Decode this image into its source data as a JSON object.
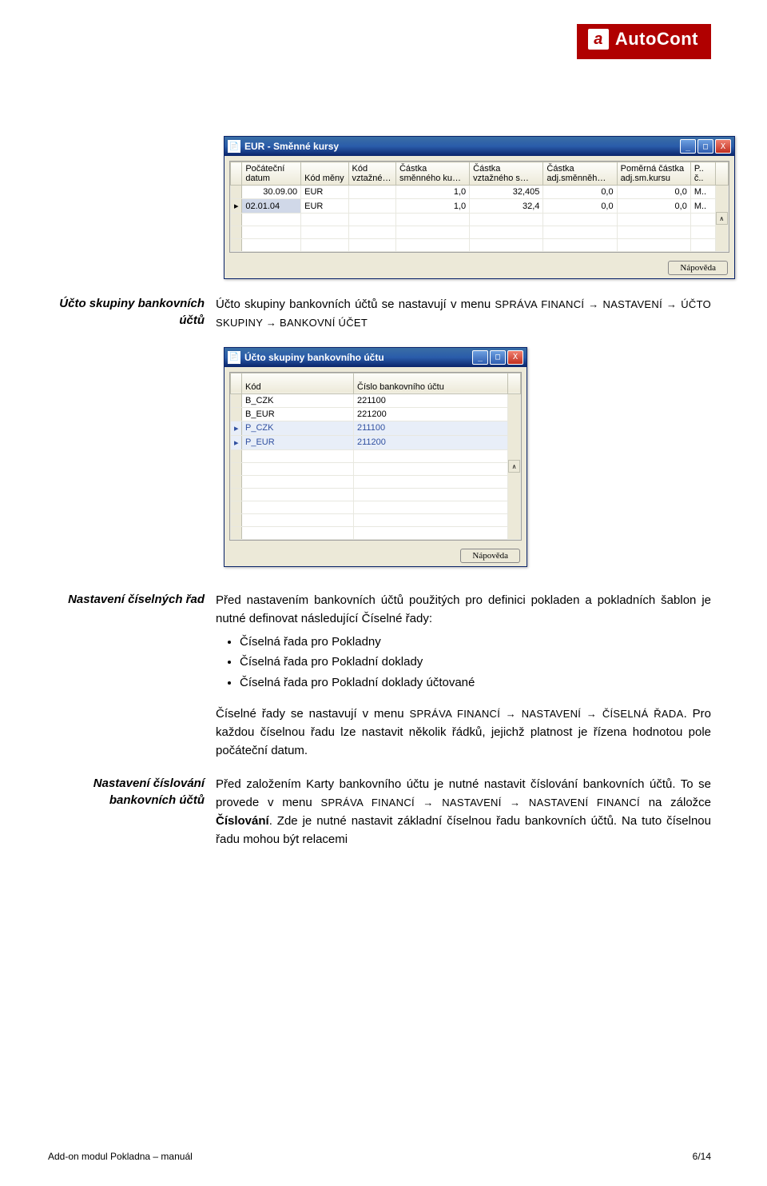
{
  "logo": {
    "mark": "a",
    "text": "AutoCont"
  },
  "window1": {
    "title": "EUR - Směnné kursy",
    "headers": [
      "Počáteční datum",
      "Kód měny",
      "Kód vztažné…",
      "Částka směnného ku…",
      "Částka vztažného s…",
      "Částka adj.směnněh…",
      "Poměrná částka adj.sm.kursu",
      "P.. č.."
    ],
    "row1": [
      "30.09.00",
      "EUR",
      "",
      "1,0",
      "32,405",
      "0,0",
      "0,0",
      "M.."
    ],
    "row2": [
      "02.01.04",
      "EUR",
      "",
      "1,0",
      "32,4",
      "0,0",
      "0,0",
      "M.."
    ],
    "button": "Nápověda"
  },
  "section1": {
    "label": "Účto skupiny bankovních účtů",
    "text_a": "Účto skupiny bankovních účtů se nastavují v menu ",
    "text_b": "SPRÁVA FINANCÍ → NASTAVENÍ → ÚČTO SKUPINY → BANKOVNÍ ÚČET"
  },
  "window2": {
    "title": "Účto skupiny bankovního účtu",
    "headers": [
      "Kód",
      "Číslo bankovního účtu"
    ],
    "rows": [
      {
        "kod": "B_CZK",
        "ucet": "221100",
        "sel": false
      },
      {
        "kod": "B_EUR",
        "ucet": "221200",
        "sel": false
      },
      {
        "kod": "P_CZK",
        "ucet": "211100",
        "sel": true
      },
      {
        "kod": "P_EUR",
        "ucet": "211200",
        "sel": true
      }
    ],
    "button": "Nápověda"
  },
  "section2": {
    "label": "Nastavení číselných řad",
    "p1": "Před nastavením bankovních účtů použitých pro definici pokladen a pokladních šablon je nutné definovat následující Číselné řady:",
    "li1": "Číselná řada pro Pokladny",
    "li2": "Číselná řada pro Pokladní doklady",
    "li3": "Číselná řada pro Pokladní doklady účtované",
    "p2a": "Číselné řady se nastavují v menu ",
    "p2b": "SPRÁVA FINANCÍ → NASTAVENÍ → ČÍSELNÁ ŘADA",
    "p2c": ". Pro každou číselnou řadu lze nastavit několik řádků, jejichž platnost je řízena hodnotou pole počáteční datum."
  },
  "section3": {
    "label": "Nastavení číslování bankovních účtů",
    "p1a": "Před založením Karty bankovního účtu je nutné nastavit číslování bankovních účtů. To se provede v menu ",
    "p1b": "SPRÁVA FINANCÍ → NASTAVENÍ → NASTAVENÍ FINANCÍ",
    "p1c": " na záložce ",
    "p1d": "Číslování",
    "p1e": ". Zde je nutné nastavit základní číselnou řadu bankovních účtů. Na tuto číselnou řadu mohou být relacemi"
  },
  "footer": {
    "left": "Add-on modul Pokladna – manuál",
    "right": "6/14"
  }
}
